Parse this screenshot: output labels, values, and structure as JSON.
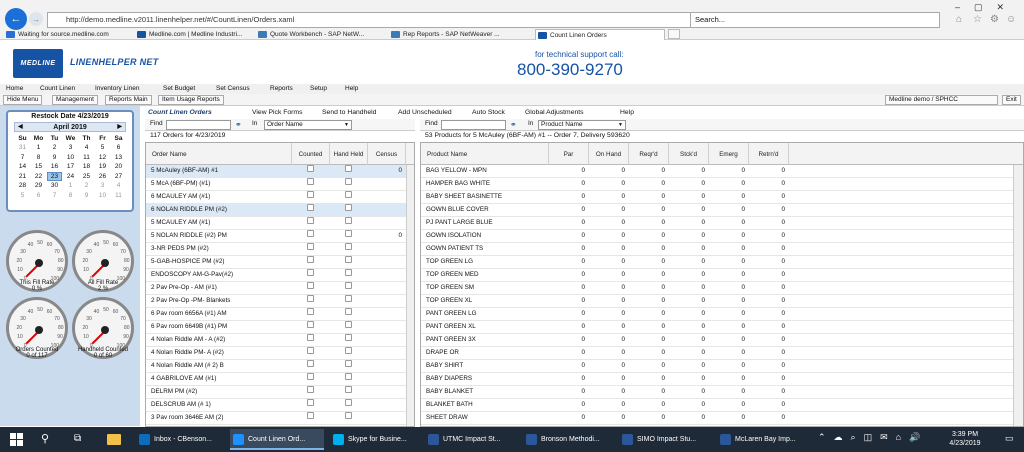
{
  "browser": {
    "url": "http://demo.medline.v2011.linenhelper.net/#/CountLinen/Orders.xaml",
    "search_placeholder": "Search...",
    "active_tab": "Count Linen Orders",
    "favorites": [
      {
        "label": "Waiting for source.medline.com",
        "color": "#2a6fd6"
      },
      {
        "label": "Medline.com | Medline Industri...",
        "color": "#1753a4"
      },
      {
        "label": "Quote Workbench - SAP NetW...",
        "color": "#3c7bb5"
      },
      {
        "label": "Rep Reports - SAP NetWeaver ...",
        "color": "#3c7bb5"
      }
    ]
  },
  "app": {
    "logo": "MEDLINE",
    "name": "LINENHELPER NET",
    "support_label": "for technical support call:",
    "support_phone": "800-390-9270",
    "menu": [
      "Home",
      "Count Linen",
      "Inventory Linen",
      "Set Budget",
      "Set Census",
      "Reports",
      "Setup",
      "Help"
    ],
    "toolbar": {
      "hide_menu": "Hide Menu",
      "management": "Management",
      "reports_main": "Reports Main",
      "item_usage": "Item Usage Reports",
      "user": "Medline demo / SPHCC",
      "exit": "Exit"
    }
  },
  "sidebar": {
    "restock_date": "Restock Date 4/23/2019",
    "calendar": {
      "month": "April 2019",
      "days_of_week": [
        "Su",
        "Mo",
        "Tu",
        "We",
        "Th",
        "Fr",
        "Sa"
      ],
      "weeks": [
        [
          "31",
          "1",
          "2",
          "3",
          "4",
          "5",
          "6"
        ],
        [
          "7",
          "8",
          "9",
          "10",
          "11",
          "12",
          "13"
        ],
        [
          "14",
          "15",
          "16",
          "17",
          "18",
          "19",
          "20"
        ],
        [
          "21",
          "22",
          "23",
          "24",
          "25",
          "26",
          "27"
        ],
        [
          "28",
          "29",
          "30",
          "1",
          "2",
          "3",
          "4"
        ],
        [
          "5",
          "6",
          "7",
          "8",
          "9",
          "10",
          "11"
        ]
      ],
      "selected_day": "23"
    },
    "gauges": [
      {
        "label": "This Fill Rate",
        "value": "0 %"
      },
      {
        "label": "All Fill Rate",
        "value": "2 %"
      },
      {
        "label": "Orders Counted",
        "value": "0 of 117"
      },
      {
        "label": "Handheld Counted",
        "value": "0 of 60"
      }
    ]
  },
  "orders_panel": {
    "title": "Count Linen Orders",
    "find_label": "Find",
    "in_label": "In",
    "in_value": "Order Name",
    "count_text": "117 Orders for 4/23/2019",
    "columns": [
      "Order Name",
      "Counted",
      "Hand Held",
      "Census"
    ],
    "rows": [
      {
        "name": "5 McAuley (6BF-AM) #1",
        "census": "0"
      },
      {
        "name": "5 McA (6BF-PM) (#1)",
        "census": ""
      },
      {
        "name": "6 MCAULEY  AM  (#1)",
        "census": ""
      },
      {
        "name": "6 NOLAN RIDDLE PM  (#2)",
        "census": ""
      },
      {
        "name": "5 MCAULEY AM  (#1)",
        "census": ""
      },
      {
        "name": "5 NOLAN RIDDLE (#2) PM",
        "census": "0"
      },
      {
        "name": "3-NR PEDS PM (#2)",
        "census": ""
      },
      {
        "name": "5-GAB-HOSPICE  PM  (#2)",
        "census": ""
      },
      {
        "name": "ENDOSCOPY AM-G-Pav(#2)",
        "census": ""
      },
      {
        "name": "2 Pav Pre-Op -  AM (#1)",
        "census": ""
      },
      {
        "name": "2 Pav Pre-Op -PM- Blankets",
        "census": ""
      },
      {
        "name": "6 Pav room 6656A (#1) AM",
        "census": ""
      },
      {
        "name": "6 Pav room 6649B (#1) PM",
        "census": ""
      },
      {
        "name": "4 Nolan Riddle AM - A (#2)",
        "census": ""
      },
      {
        "name": "4 Nolan Riddle PM- A (#2)",
        "census": ""
      },
      {
        "name": "4 Nolan Riddle AM (# 2) B",
        "census": ""
      },
      {
        "name": "4 GABRILOVE  AM  (#1)",
        "census": ""
      },
      {
        "name": "DELRM  PM  (#2)",
        "census": ""
      },
      {
        "name": "DELSCRUB AM (# 1)",
        "census": ""
      },
      {
        "name": "3 Pav room 3646E AM (2)",
        "census": ""
      }
    ]
  },
  "actions": [
    "View Pick Forms",
    "Send to Handheld",
    "Add Unscheduled",
    "Auto Stock",
    "Global Adjustments",
    "Help"
  ],
  "products_panel": {
    "find_label": "Find",
    "in_label": "In",
    "in_value": "Product Name",
    "count_text": "53 Products for 5 McAuley (6BF-AM) #1 -- Order 7, Delivery 593620",
    "columns": [
      "Product Name",
      "Par",
      "On Hand",
      "Reqr'd",
      "Stck'd",
      "Emerg",
      "Retrn'd"
    ],
    "rows": [
      {
        "name": "BAG YELLOW - MPN",
        "vals": [
          "0",
          "0",
          "0",
          "0",
          "0",
          "0"
        ]
      },
      {
        "name": "HAMPER BAG WHITE",
        "vals": [
          "0",
          "0",
          "0",
          "0",
          "0",
          "0"
        ]
      },
      {
        "name": "BABY SHEET BASINETTE",
        "vals": [
          "0",
          "0",
          "0",
          "0",
          "0",
          "0"
        ]
      },
      {
        "name": "GOWN BLUE COVER",
        "vals": [
          "0",
          "0",
          "0",
          "0",
          "0",
          "0"
        ]
      },
      {
        "name": "PJ PANT LARGE BLUE",
        "vals": [
          "0",
          "0",
          "0",
          "0",
          "0",
          "0"
        ]
      },
      {
        "name": "GOWN ISOLATION",
        "vals": [
          "0",
          "0",
          "0",
          "0",
          "0",
          "0"
        ]
      },
      {
        "name": "GOWN PATIENT TS",
        "vals": [
          "0",
          "0",
          "0",
          "0",
          "0",
          "0"
        ]
      },
      {
        "name": "TOP GREEN LG",
        "vals": [
          "0",
          "0",
          "0",
          "0",
          "0",
          "0"
        ]
      },
      {
        "name": "TOP GREEN MED",
        "vals": [
          "0",
          "0",
          "0",
          "0",
          "0",
          "0"
        ]
      },
      {
        "name": "TOP GREEN SM",
        "vals": [
          "0",
          "0",
          "0",
          "0",
          "0",
          "0"
        ]
      },
      {
        "name": "TOP GREEN XL",
        "vals": [
          "0",
          "0",
          "0",
          "0",
          "0",
          "0"
        ]
      },
      {
        "name": "PANT GREEN LG",
        "vals": [
          "0",
          "0",
          "0",
          "0",
          "0",
          "0"
        ]
      },
      {
        "name": "PANT GREEN XL",
        "vals": [
          "0",
          "0",
          "0",
          "0",
          "0",
          "0"
        ]
      },
      {
        "name": "PANT GREEN 3X",
        "vals": [
          "0",
          "0",
          "0",
          "0",
          "0",
          "0"
        ]
      },
      {
        "name": "DRAPE OR",
        "vals": [
          "0",
          "0",
          "0",
          "0",
          "0",
          "0"
        ]
      },
      {
        "name": "BABY SHIRT",
        "vals": [
          "0",
          "0",
          "0",
          "0",
          "0",
          "0"
        ]
      },
      {
        "name": "BABY DIAPERS",
        "vals": [
          "0",
          "0",
          "0",
          "0",
          "0",
          "0"
        ]
      },
      {
        "name": "BABY BLANKET",
        "vals": [
          "0",
          "0",
          "0",
          "0",
          "0",
          "0"
        ]
      },
      {
        "name": "BLANKET BATH",
        "vals": [
          "0",
          "0",
          "0",
          "0",
          "0",
          "0"
        ]
      },
      {
        "name": "SHEET DRAW",
        "vals": [
          "0",
          "0",
          "0",
          "0",
          "0",
          "0"
        ]
      }
    ]
  },
  "taskbar": {
    "items": [
      {
        "label": "Inbox - CBenson...",
        "color": "#0f6cbd",
        "active": false
      },
      {
        "label": "Count Linen Ord...",
        "color": "#1e90ff",
        "active": true
      },
      {
        "label": "Skype for Busine...",
        "color": "#00aff0",
        "active": false
      },
      {
        "label": "UTMC Impact St...",
        "color": "#2b579a",
        "active": false
      },
      {
        "label": "Bronson Methodi...",
        "color": "#2b579a",
        "active": false
      },
      {
        "label": "SIMO Impact Stu...",
        "color": "#2b579a",
        "active": false
      },
      {
        "label": "McLaren Bay Imp...",
        "color": "#2b579a",
        "active": false
      }
    ],
    "time": "3:39 PM",
    "date": "4/23/2019"
  }
}
